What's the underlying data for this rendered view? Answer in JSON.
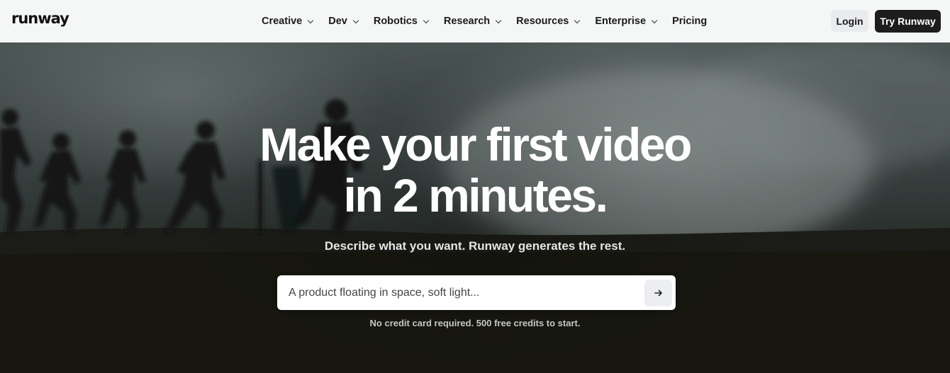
{
  "nav": {
    "logo": "runway",
    "items": [
      {
        "label": "Creative",
        "dropdown": true
      },
      {
        "label": "Dev",
        "dropdown": true
      },
      {
        "label": "Robotics",
        "dropdown": true
      },
      {
        "label": "Research",
        "dropdown": true
      },
      {
        "label": "Resources",
        "dropdown": true
      },
      {
        "label": "Enterprise",
        "dropdown": true
      },
      {
        "label": "Pricing",
        "dropdown": false
      }
    ],
    "login_label": "Login",
    "try_label": "Try Runway"
  },
  "hero": {
    "headline_line1": "Make your first video",
    "headline_line2": "in 2 minutes.",
    "subline": "Describe what you want. Runway generates the rest.",
    "prompt_placeholder": "A product floating in space, soft light...",
    "submit_icon": "arrow-right-icon",
    "footnote": "No credit card required. 500 free credits to start."
  },
  "colors": {
    "nav_bg": "#f5f6f6",
    "try_button_bg": "#1d1d1d",
    "login_button_bg": "#e9ebee",
    "text_dark": "#1a1a1a"
  }
}
